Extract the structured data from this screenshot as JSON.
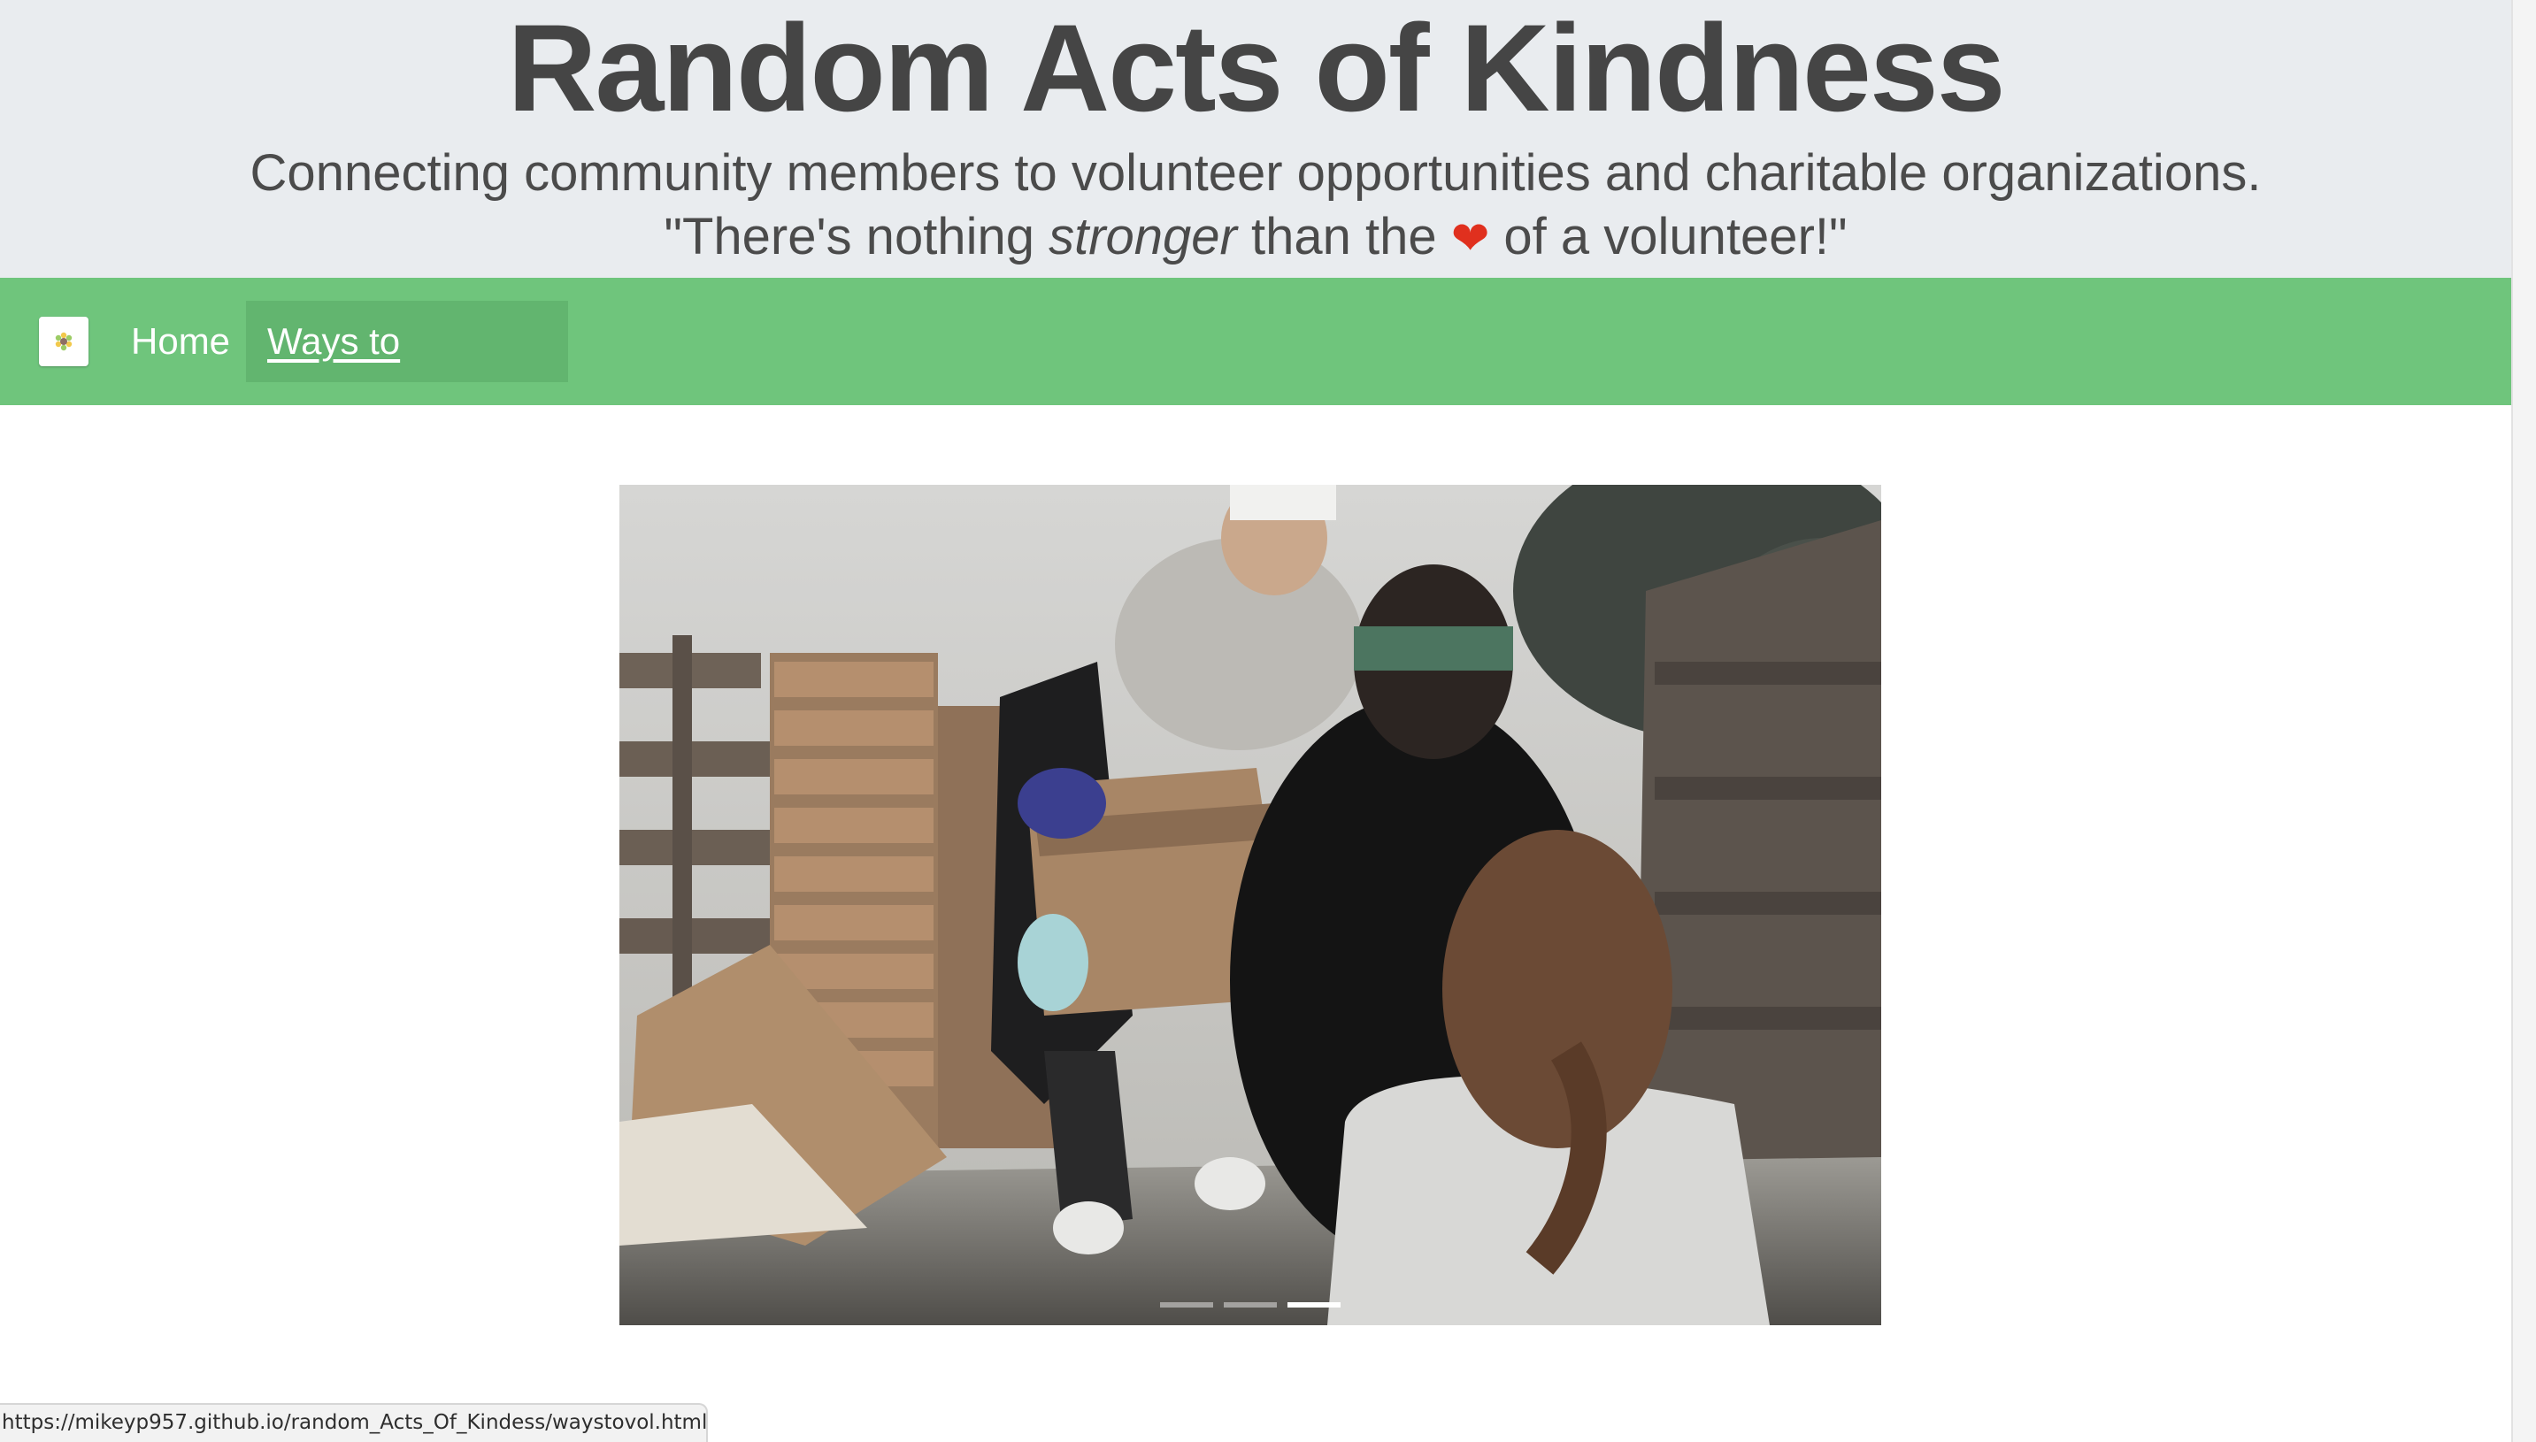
{
  "header": {
    "title": "Random Acts of Kindness",
    "tagline": "Connecting community members to volunteer opportunities and charitable organizations.",
    "quote_prefix": "\"There's nothing ",
    "quote_emphasis": "stronger",
    "quote_middle": " than the ",
    "quote_heart": "❤",
    "quote_suffix": " of a volunteer!\""
  },
  "navbar": {
    "brand_icon": "sunflower-logo-icon",
    "links": [
      {
        "label": "Home",
        "active": false
      },
      {
        "label": "Ways to Volunteer",
        "active": true
      }
    ],
    "color": "#6fc57c"
  },
  "carousel": {
    "slide_count": 3,
    "active_index": 2
  },
  "status_bar": {
    "url": "https://mikeyp957.github.io/random_Acts_Of_Kindess/waystovol.html"
  },
  "colors": {
    "header_bg": "#e9ecef",
    "heart": "#e0301e"
  }
}
